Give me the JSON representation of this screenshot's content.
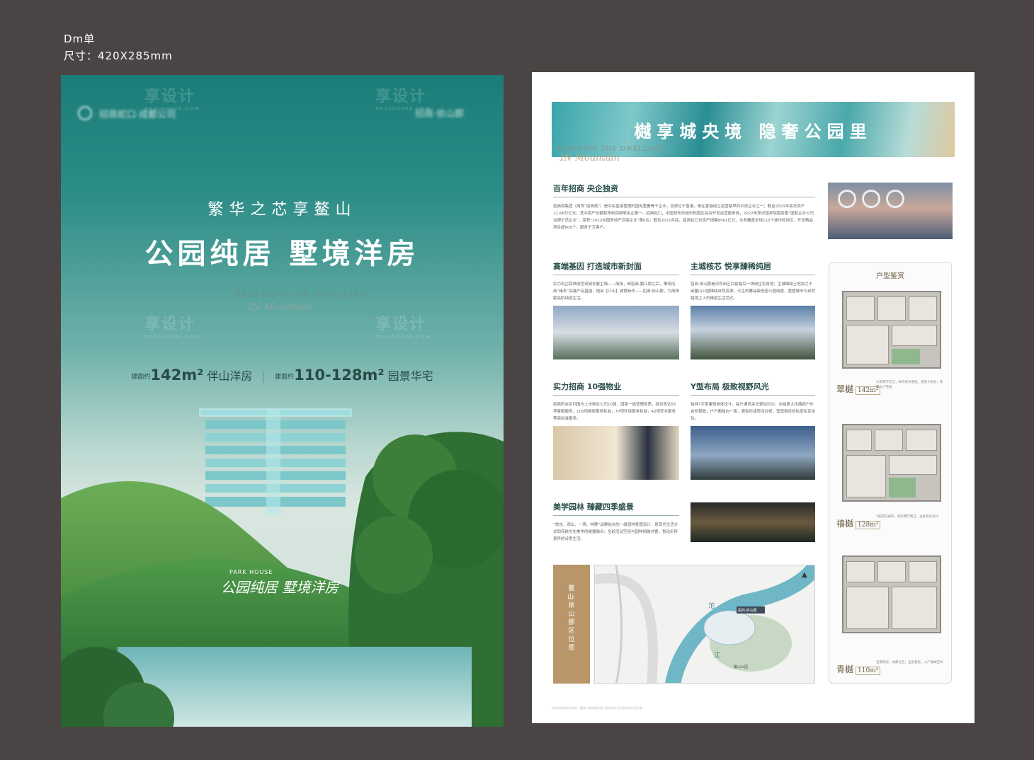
{
  "spec": {
    "line1": "Dm单",
    "line2": "尺寸：420X285mm"
  },
  "front": {
    "logo_text": "招商蛇口·成都公司",
    "logo_right": "招商·依山郡",
    "subtitle": "繁华之芯享鳌山",
    "title": "公园纯居  墅境洋房",
    "en_line": "REDEFINE THE DWELLING",
    "en_script": "IN Mountain",
    "area_tag": "建面约",
    "area1_num": "142m²",
    "area1_label": "伴山洋房",
    "area_sep": "|",
    "area2_num": "110-128m²",
    "area2_label": "园景华宅",
    "slogan_en": "PARK HOUSE",
    "slogan": "公园纯居 墅境洋房"
  },
  "back": {
    "banner_title": "樾享城央境  隐奢公园里",
    "banner_en": "REDEFINE THE DWELLING",
    "banner_en2": "IN Mountain",
    "sections": [
      {
        "title": "百年招商 央企独资",
        "text": "招商局集团（简称“招商局”）是中央直接管理的国有重要骨干企业，总部位于香港，是在香港成立运营最早的中资企业之一；截至2021年底总资产11.66万亿元，其中资产总额和净利润排联央企第一。招商蛇口，中国领先的城市和园区综合开发运营服务商，2022年获评国务院国资委“国有企业公司治理示范企业”，荣获“2022中国房地产百强企业”第6名；截至2021年底，招商蛇口总资产规模8562亿元，业务覆盖全球110个城市和地区，开发精品项目超600个，服务于万客户。"
      },
      {
        "title": "高端基因 打造城市新封面",
        "text": "实力央企踩陆成宫双城发展主轴——简阳，继招商·鹏江旗之后，秉传招商“雍系”高端产品基因，植启【江山】诚意新作——招商·依山郡，为简阳献高阶纯居生活。"
      },
      {
        "title": "主城核芯 悦享臻稀纯居",
        "text": "招商·依山郡是河东新区目前最后一块纯住宅用地；主城稀缺土地加之千亩鳌山公园稀缺自然资源，天生的雕品级低密公园纯居，重塑城市与自然踏境之上的峰层生活范式。"
      },
      {
        "title": "实力招商 10强物业",
        "text": "招商积余名列国内上市物业公司10强，国家一级管理资质，提供多达55项客服服务，105项维修服务标准，77项环境服务标准，42项安全服务等高标准服务。"
      },
      {
        "title": "Y型布局 极致视野风光",
        "text": "独特Y字型建筑单体设计，每户通风采光更加均匀，亦能更大化拥揽户外自然景致；户户都独向一面，避免形成房间对视，营造极佳的私密私享体验。"
      },
      {
        "title": "美学园林 臻藏四季盛景",
        "text": "“悦水、观山、一境、林静”动静结合的一级园林景观设计，是现代生活方式和传统文化美学的碰撞融合；全龄活动空间与园林相融并置，悦动步移景异的诗意生活。"
      }
    ],
    "plan_panel_title": "户型鉴赏",
    "plans": [
      {
        "name": "翠樾",
        "area": "142m²",
        "note": "三房两厅双卫，纵向采光通透，宽景大阳台，私属入户花园"
      },
      {
        "name": "禧樾",
        "area": "128m²",
        "note": "Y型南向通风，四房两厅两卫，主卧套房设计"
      },
      {
        "name": "青樾",
        "area": "110m²",
        "note": "全明四房，动静分区，主卧套房，入户收纳空间"
      }
    ],
    "map_side_text": "鳌山·依山郡区位图",
    "map_labels": [
      "沱",
      "江",
      "鳌山公园",
      "招商·依山郡"
    ],
    "footer_note": "本宣传资料仅供参考，最终以政府相关部门批准文件及买卖合同约定为准"
  },
  "watermark": {
    "cn": "享设计",
    "en": "DESIGN006.COM"
  }
}
